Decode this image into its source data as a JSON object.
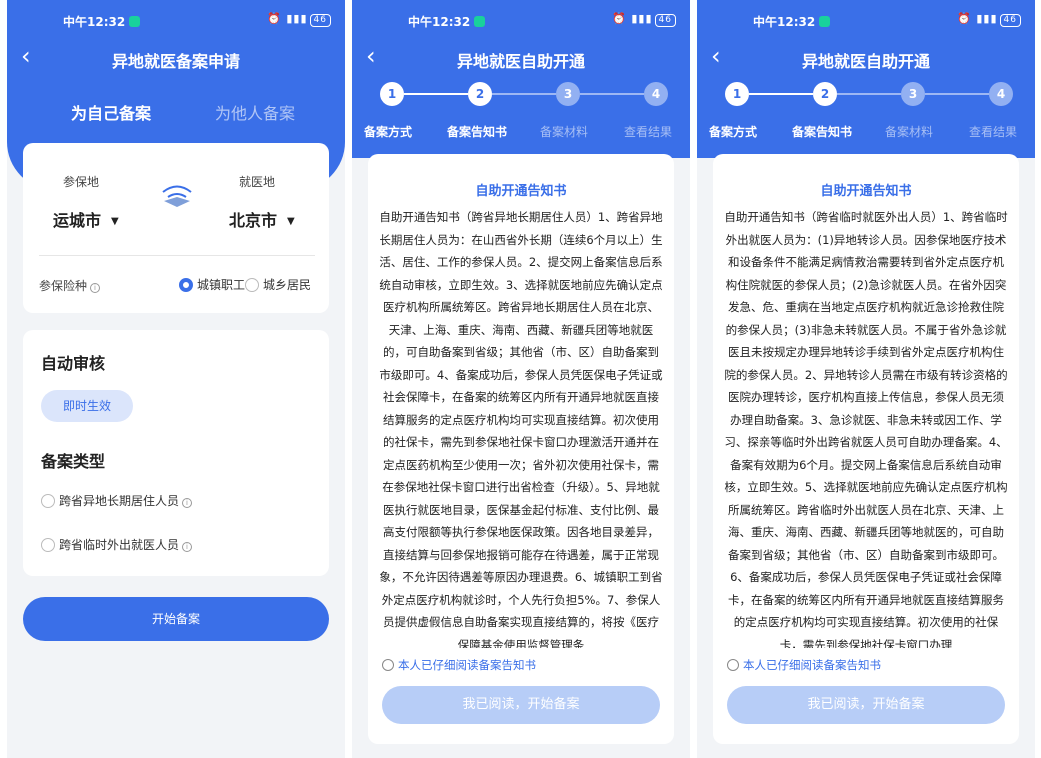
{
  "status": {
    "time": "中午12:32",
    "signal": "4G",
    "battery": "46"
  },
  "screen1": {
    "title": "异地就医备案申请",
    "tabs": [
      "为自己备案",
      "为他人备案"
    ],
    "insured_place_label": "参保地",
    "insured_place_value": "运城市",
    "medical_place_label": "就医地",
    "medical_place_value": "北京市",
    "insurance_type_label": "参保险种",
    "insurance_options": [
      "城镇职工",
      "城乡居民"
    ],
    "auto_review_title": "自动审核",
    "auto_review_pill": "即时生效",
    "record_type_title": "备案类型",
    "record_types": [
      "跨省异地长期居住人员",
      "跨省临时外出就医人员"
    ],
    "start_button": "开始备案"
  },
  "screen2": {
    "title": "异地就医自助开通",
    "steps": [
      "1",
      "2",
      "3",
      "4"
    ],
    "step_labels": [
      "备案方式",
      "备案告知书",
      "备案材料",
      "查看结果"
    ],
    "notice_title": "自助开通告知书",
    "notice_body": "自助开通告知书（跨省异地长期居住人员）1、跨省异地长期居住人员为：在山西省外长期（连续6个月以上）生活、居住、工作的参保人员。2、提交网上备案信息后系统自动审核，立即生效。3、选择就医地前应先确认定点医疗机构所属统筹区。跨省异地长期居住人员在北京、天津、上海、重庆、海南、西藏、新疆兵团等地就医的，可自助备案到省级；其他省（市、区）自助备案到市级即可。4、备案成功后，参保人员凭医保电子凭证或社会保障卡，在备案的统筹区内所有开通异地就医直接结算服务的定点医疗机构均可实现直接结算。初次使用的社保卡，需先到参保地社保卡窗口办理激活开通并在定点医药机构至少使用一次；省外初次使用社保卡，需在参保地社保卡窗口进行出省检查（升级）。5、异地就医执行就医地目录，医保基金起付标准、支付比例、最高支付限额等执行参保地医保政策。因各地目录差异，直接结算与回参保地报销可能存在待遇差，属于正常现象，不允许因待遇差等原因办理退费。6、城镇职工到省外定点医疗机构就诊时，个人先行负担5%。7、参保人员提供虚假信息自助备案实现直接结算的，将按《医疗保障基金使用监督管理条",
    "agree_text": "本人已仔细阅读备案告知书",
    "read_button": "我已阅读，开始备案"
  },
  "screen3": {
    "title": "异地就医自助开通",
    "steps": [
      "1",
      "2",
      "3",
      "4"
    ],
    "step_labels": [
      "备案方式",
      "备案告知书",
      "备案材料",
      "查看结果"
    ],
    "notice_title": "自助开通告知书",
    "notice_body": "自助开通告知书（跨省临时就医外出人员）1、跨省临时外出就医人员为：(1)异地转诊人员。因参保地医疗技术和设备条件不能满足病情救治需要转到省外定点医疗机构住院就医的参保人员；(2)急诊就医人员。在省外因突发急、危、重病在当地定点医疗机构就近急诊抢救住院的参保人员；(3)非急未转就医人员。不属于省外急诊就医且未按规定办理异地转诊手续到省外定点医疗机构住院的参保人员。2、异地转诊人员需在市级有转诊资格的医院办理转诊，医疗机构直接上传信息，参保人员无须办理自助备案。3、急诊就医、非急未转或因工作、学习、探亲等临时外出跨省就医人员可自助办理备案。4、备案有效期为6个月。提交网上备案信息后系统自动审核，立即生效。5、选择就医地前应先确认定点医疗机构所属统筹区。跨省临时外出就医人员在北京、天津、上海、重庆、海南、西藏、新疆兵团等地就医的，可自助备案到省级；其他省（市、区）自助备案到市级即可。6、备案成功后，参保人员凭医保电子凭证或社会保障卡，在备案的统筹区内所有开通异地就医直接结算服务的定点医疗机构均可实现直接结算。初次使用的社保卡，需先到参保地社保卡窗口办理",
    "agree_text": "本人已仔细阅读备案告知书",
    "read_button": "我已阅读，开始备案"
  },
  "colors": {
    "primary": "#3a6fe8",
    "pill_bg": "#dbe5fb",
    "disabled_button": "#b7cdf7",
    "status_dot": "#19d19c"
  }
}
